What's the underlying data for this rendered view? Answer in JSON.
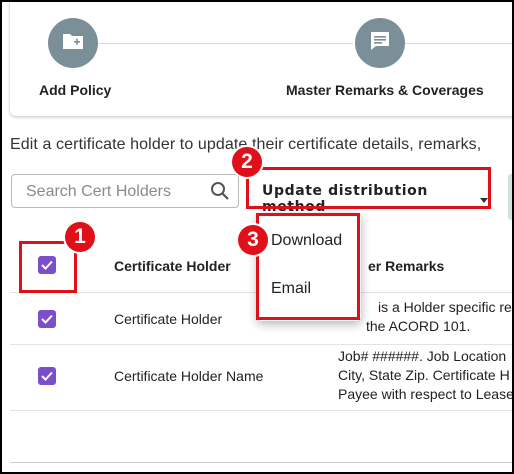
{
  "stepper": {
    "steps": [
      {
        "label": "Add Policy",
        "icon": "folder-plus-icon"
      },
      {
        "label": "Master Remarks & Coverages",
        "icon": "comment-icon"
      }
    ],
    "circle_color": "#7b8f99"
  },
  "description": "Edit a certificate holder to update their certificate details, remarks,",
  "search": {
    "placeholder": "Search Cert Holders",
    "value": ""
  },
  "update_button": {
    "label": "Update distribution method"
  },
  "dropdown": {
    "items": [
      {
        "label": "Download"
      },
      {
        "label": "Email"
      }
    ]
  },
  "callouts": [
    "1",
    "2",
    "3"
  ],
  "table": {
    "headers": {
      "holder": "Certificate Holder",
      "remarks_partial": "er Remarks"
    },
    "rows": [
      {
        "checked": true,
        "holder": "Certificate Holder",
        "remarks": [
          "is a Holder specific rem",
          "the ACORD 101."
        ]
      },
      {
        "checked": true,
        "holder": "Certificate Holder Name",
        "remarks": [
          "Job# ######. Job Location",
          "City, State Zip. Certificate H",
          "Payee with respect to Lease"
        ]
      }
    ]
  },
  "colors": {
    "accent": "#7b4fc9",
    "callout": "#e0101a"
  }
}
